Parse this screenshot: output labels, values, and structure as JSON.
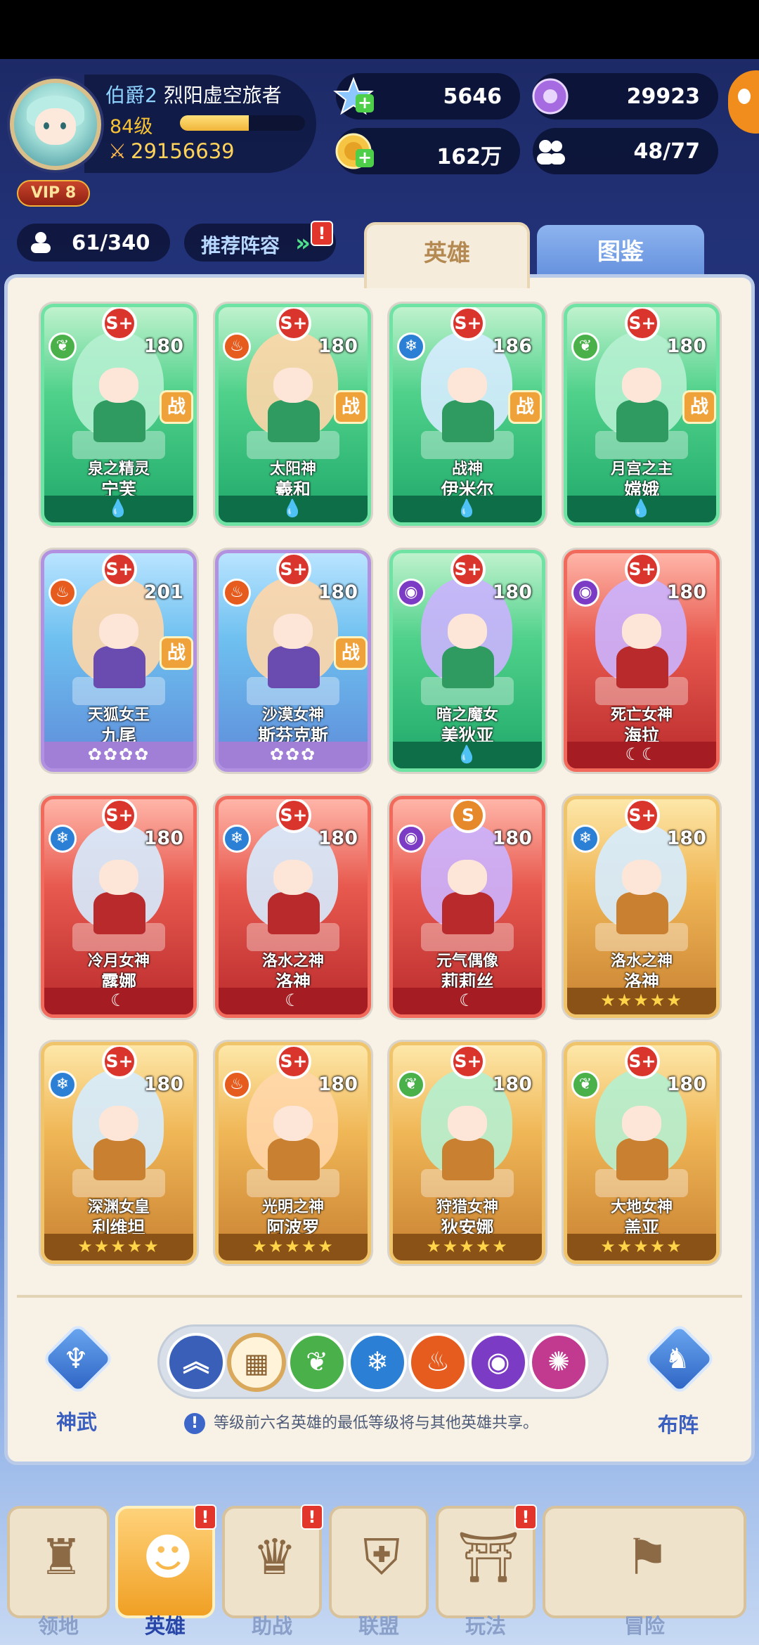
{
  "player": {
    "rank": "伯爵2",
    "name": "烈阳虚空旅者",
    "level": "84级",
    "level_progress": 0.55,
    "power": "29156639",
    "vip": "VIP 8"
  },
  "resources": {
    "gems": "5646",
    "crystals": "29923",
    "gold": "162万",
    "members": "48/77"
  },
  "hero_count": "61/340",
  "recommend_label": "推荐阵容",
  "tabs": {
    "heroes": "英雄",
    "dex": "图鉴"
  },
  "cards": [
    {
      "title": "泉之精灵",
      "name": "宁芙",
      "level": "180",
      "grade": "S+",
      "element": "nature",
      "frame": "green",
      "war": "战",
      "footer": "💧"
    },
    {
      "title": "太阳神",
      "name": "羲和",
      "level": "180",
      "grade": "S+",
      "element": "fire",
      "frame": "green",
      "war": "战",
      "footer": "💧"
    },
    {
      "title": "战神",
      "name": "伊米尔",
      "level": "186",
      "grade": "S+",
      "element": "ice",
      "frame": "green",
      "war": "战",
      "footer": "💧"
    },
    {
      "title": "月宫之主",
      "name": "嫦娥",
      "level": "180",
      "grade": "S+",
      "element": "nature",
      "frame": "green",
      "war": "战",
      "footer": "💧"
    },
    {
      "title": "天狐女王",
      "name": "九尾",
      "level": "201",
      "grade": "S+",
      "element": "fire",
      "frame": "purple",
      "war": "战",
      "footer": "✿✿✿✿"
    },
    {
      "title": "沙漠女神",
      "name": "斯芬克斯",
      "level": "180",
      "grade": "S+",
      "element": "fire",
      "frame": "purple",
      "war": "战",
      "footer": "✿✿✿"
    },
    {
      "title": "暗之魔女",
      "name": "美狄亚",
      "level": "180",
      "grade": "S+",
      "element": "shadow",
      "frame": "green",
      "war": "",
      "footer": "💧"
    },
    {
      "title": "死亡女神",
      "name": "海拉",
      "level": "180",
      "grade": "S+",
      "element": "shadow",
      "frame": "red",
      "war": "",
      "footer": "☾☾"
    },
    {
      "title": "冷月女神",
      "name": "露娜",
      "level": "180",
      "grade": "S+",
      "element": "ice",
      "frame": "red",
      "war": "",
      "footer": "☾"
    },
    {
      "title": "洛水之神",
      "name": "洛神",
      "level": "180",
      "grade": "S+",
      "element": "ice",
      "frame": "red",
      "war": "",
      "footer": "☾"
    },
    {
      "title": "元气偶像",
      "name": "莉莉丝",
      "level": "180",
      "grade": "S",
      "element": "shadow",
      "frame": "red",
      "war": "",
      "footer": "☾"
    },
    {
      "title": "洛水之神",
      "name": "洛神",
      "level": "180",
      "grade": "S+",
      "element": "ice",
      "frame": "gold",
      "war": "",
      "footer": "★★★★★"
    },
    {
      "title": "深渊女皇",
      "name": "利维坦",
      "level": "180",
      "grade": "S+",
      "element": "ice",
      "frame": "gold",
      "war": "",
      "footer": "★★★★★"
    },
    {
      "title": "光明之神",
      "name": "阿波罗",
      "level": "180",
      "grade": "S+",
      "element": "fire",
      "frame": "gold",
      "war": "",
      "footer": "★★★★★"
    },
    {
      "title": "狩猎女神",
      "name": "狄安娜",
      "level": "180",
      "grade": "S+",
      "element": "nature",
      "frame": "gold",
      "war": "",
      "footer": "★★★★★"
    },
    {
      "title": "大地女神",
      "name": "盖亚",
      "level": "180",
      "grade": "S+",
      "element": "nature",
      "frame": "gold",
      "war": "",
      "footer": "★★★★★"
    }
  ],
  "tools": {
    "left": "神武",
    "right": "布阵"
  },
  "note": "等级前六名英雄的最低等级将与其他英雄共享。",
  "nav": [
    {
      "label": "领地",
      "icon": "castle-icon",
      "badge": false
    },
    {
      "label": "英雄",
      "icon": "hero-icon",
      "badge": true
    },
    {
      "label": "助战",
      "icon": "helmet-icon",
      "badge": true
    },
    {
      "label": "联盟",
      "icon": "shield-icon",
      "badge": false
    },
    {
      "label": "玩法",
      "icon": "gate-icon",
      "badge": true
    },
    {
      "label": "冒险",
      "icon": "flag-icon",
      "badge": false
    }
  ],
  "badge_mark": "!"
}
